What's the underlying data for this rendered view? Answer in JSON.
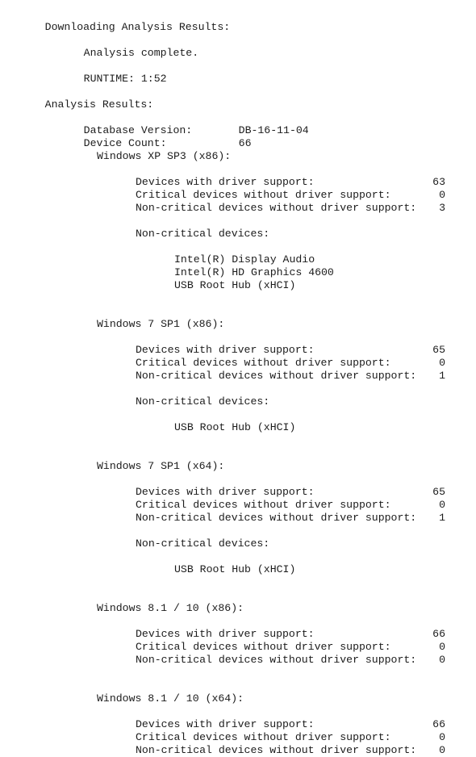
{
  "console": {
    "background_color": "#ffffff",
    "text_color": "#1c1c1c",
    "header": "Downloading Analysis Results:",
    "status": "Analysis complete.",
    "runtime_label": "RUNTIME:",
    "runtime_value": "1:52",
    "runtime_line": "RUNTIME: 1:52",
    "results_header": "Analysis Results:",
    "summary": [
      {
        "label": "Database Version:",
        "value": "DB-16-11-04"
      },
      {
        "label": "Device Count:",
        "value": "66"
      }
    ],
    "stat_labels": {
      "supported": "Devices with driver support:",
      "critical": "Critical devices without driver support:",
      "noncritical": "Non-critical devices without driver support:"
    },
    "noncritical_devices_header": "Non-critical devices:",
    "platforms": [
      {
        "name": "Windows XP SP3 (x86):",
        "supported": "63",
        "critical": "0",
        "noncritical": "3",
        "devices": [
          "Intel(R) Display Audio",
          "Intel(R) HD Graphics 4600",
          "USB Root Hub (xHCI)"
        ]
      },
      {
        "name": "Windows 7 SP1 (x86):",
        "supported": "65",
        "critical": "0",
        "noncritical": "1",
        "devices": [
          "USB Root Hub (xHCI)"
        ]
      },
      {
        "name": "Windows 7 SP1 (x64):",
        "supported": "65",
        "critical": "0",
        "noncritical": "1",
        "devices": [
          "USB Root Hub (xHCI)"
        ]
      },
      {
        "name": "Windows 8.1 / 10 (x86):",
        "supported": "66",
        "critical": "0",
        "noncritical": "0",
        "devices": []
      },
      {
        "name": "Windows 8.1 / 10 (x64):",
        "supported": "66",
        "critical": "0",
        "noncritical": "0",
        "devices": []
      }
    ]
  }
}
